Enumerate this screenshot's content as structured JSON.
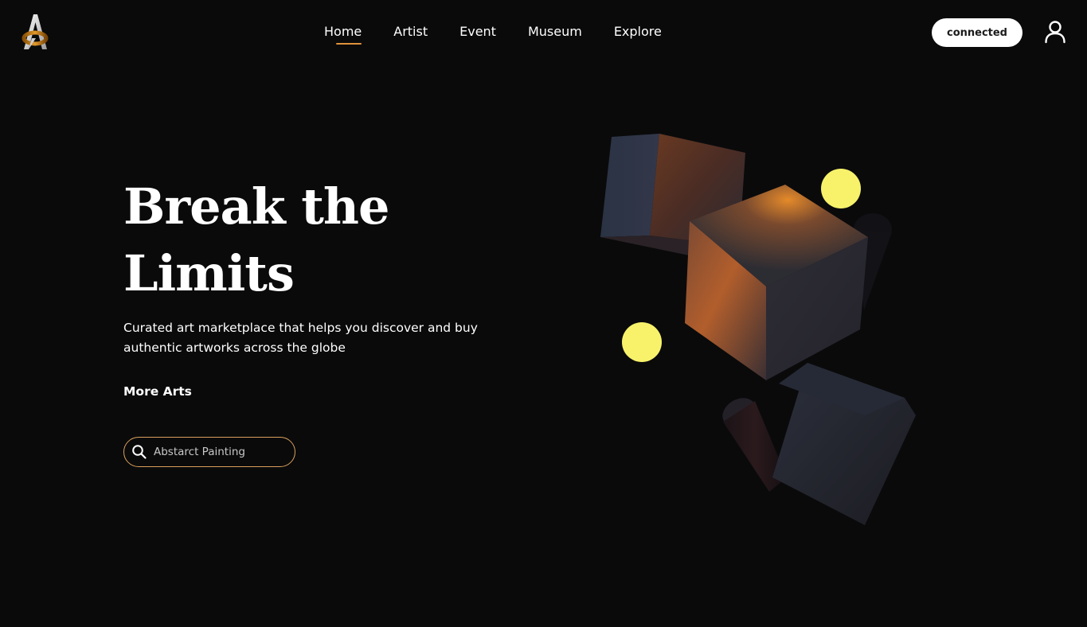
{
  "brand": {
    "logo_icon": "letter-a-logo-icon"
  },
  "nav": {
    "items": [
      {
        "label": "Home",
        "active": true
      },
      {
        "label": "Artist",
        "active": false
      },
      {
        "label": "Event",
        "active": false
      },
      {
        "label": "Museum",
        "active": false
      },
      {
        "label": "Explore",
        "active": false
      }
    ]
  },
  "header": {
    "connect_label": "connected",
    "user_icon": "user-icon"
  },
  "hero": {
    "title_line1": "Break the",
    "title_line2": "Limits",
    "subtitle_line1": "Curated art marketplace that helps you discover and buy",
    "subtitle_line2": "authentic artworks across the globe",
    "more_label": "More Arts"
  },
  "search": {
    "placeholder": "Abstarct Painting",
    "icon": "search-icon"
  },
  "colors": {
    "background": "#0a0a0b",
    "accent": "#e0913a",
    "sphere": "#f7f26a"
  }
}
